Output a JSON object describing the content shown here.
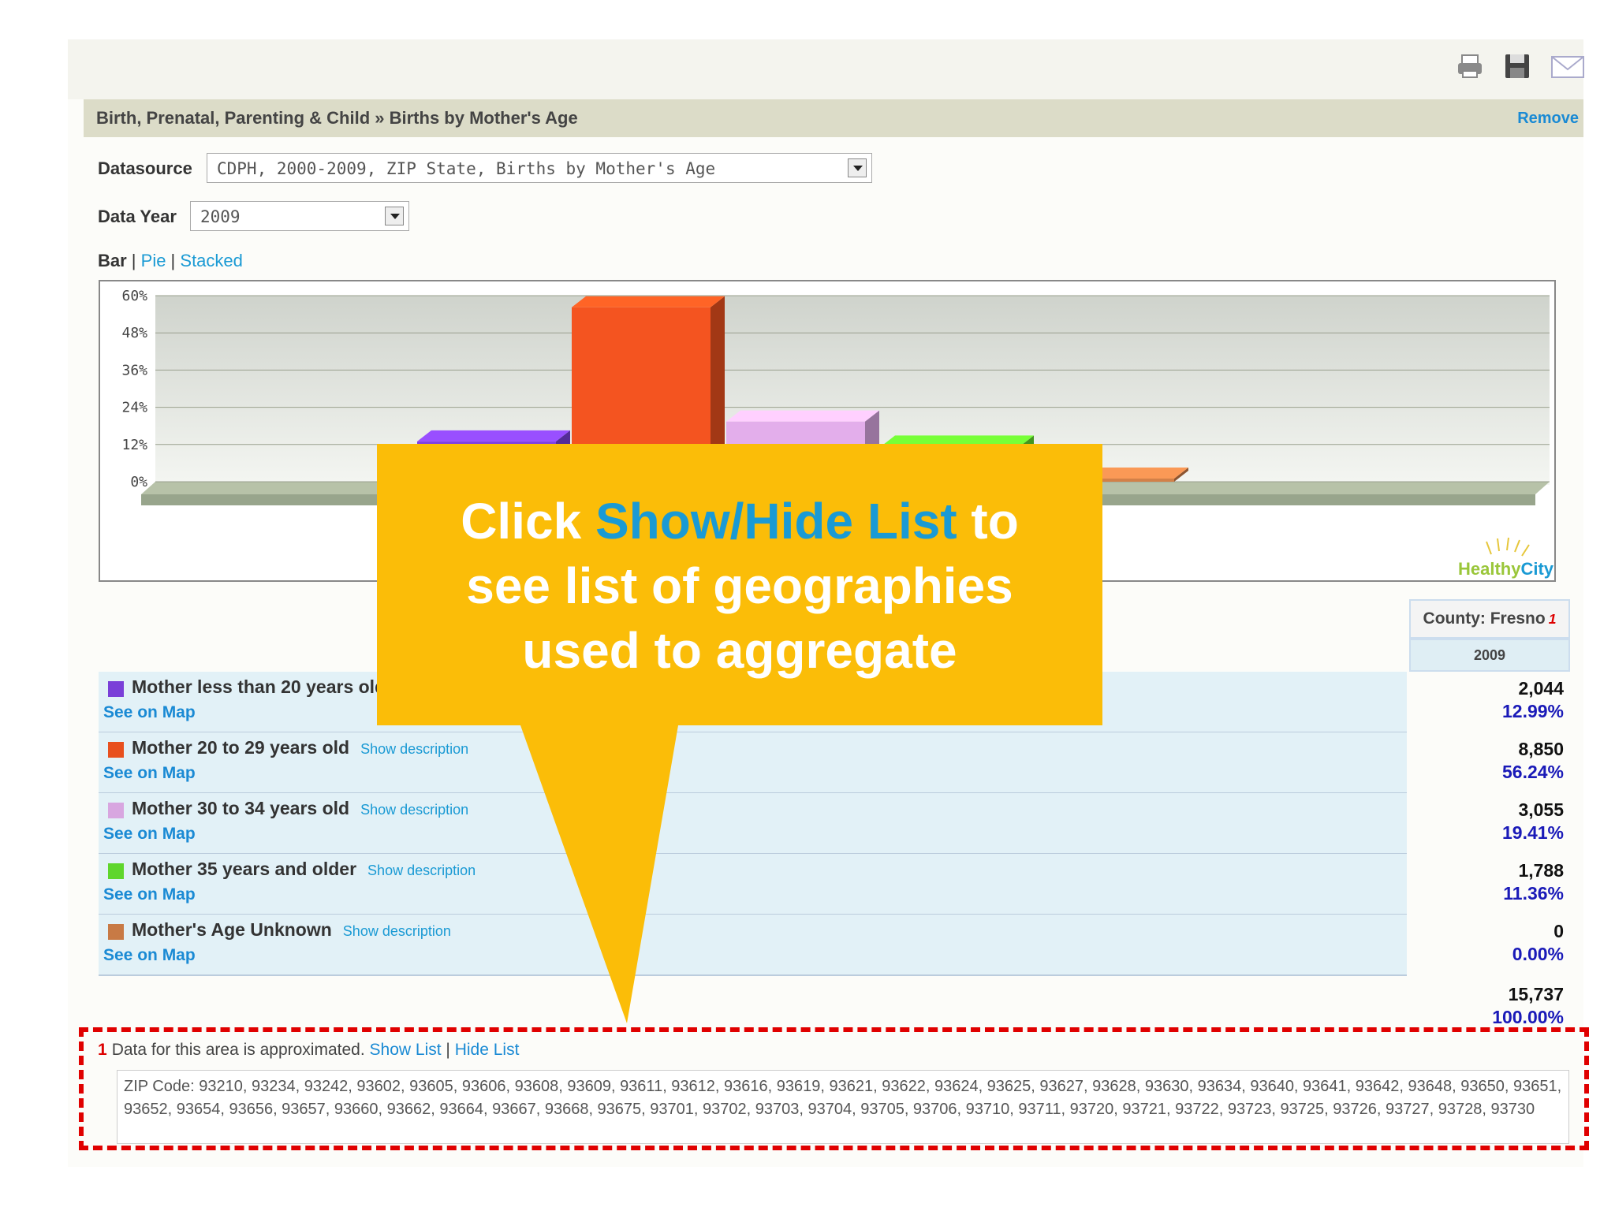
{
  "toolbar": {
    "icons": [
      "print-icon",
      "save-icon",
      "email-icon"
    ]
  },
  "breadcrumb": {
    "text": "Birth, Prenatal, Parenting & Child » Births by Mother's Age",
    "remove_label": "Remove"
  },
  "controls": {
    "datasource_label": "Datasource",
    "datasource_value": "CDPH, 2000-2009, ZIP State, Births by Mother's Age",
    "year_label": "Data Year",
    "year_value": "2009"
  },
  "chart_types": {
    "bar": "Bar",
    "sep1": " | ",
    "pie": "Pie",
    "sep2": " | ",
    "stacked": "Stacked"
  },
  "chart_data": {
    "type": "bar",
    "categories": [
      "Mother less than 20 years old",
      "Mother 20 to 29 years old",
      "Mother 30 to 34 years old",
      "Mother 35 years and older",
      "Mother's Age Unknown"
    ],
    "values": [
      12.99,
      56.24,
      19.41,
      11.36,
      0.0
    ],
    "colors": [
      "#7a3fd8",
      "#e8501e",
      "#d8a6e0",
      "#5fd62c",
      "#c87a45"
    ],
    "yticks": [
      "60%",
      "48%",
      "36%",
      "24%",
      "12%",
      "0%"
    ],
    "ylim": [
      0,
      60
    ],
    "logo": "HealthyCity"
  },
  "table": {
    "county_header": "County: Fresno",
    "county_footnote": "1",
    "year_header": "2009",
    "rows": [
      {
        "label": "Mother less than 20 years old",
        "desc": "",
        "map": "See on Map",
        "count": "2,044",
        "pct": "12.99%",
        "color": "#7a3fd8"
      },
      {
        "label": "Mother 20 to 29 years old",
        "desc": "Show description",
        "map": "See on Map",
        "count": "8,850",
        "pct": "56.24%",
        "color": "#e8501e"
      },
      {
        "label": "Mother 30 to 34 years old",
        "desc": "Show description",
        "map": "See on Map",
        "count": "3,055",
        "pct": "19.41%",
        "color": "#d8a6e0"
      },
      {
        "label": "Mother 35 years and older",
        "desc": "Show description",
        "map": "See on Map",
        "count": "1,788",
        "pct": "11.36%",
        "color": "#5fd62c"
      },
      {
        "label": "Mother's Age Unknown",
        "desc": "Show description",
        "map": "See on Map",
        "count": "0",
        "pct": "0.00%",
        "color": "#c87a45"
      }
    ],
    "total_count": "15,737",
    "total_pct": "100.00%"
  },
  "footnote": {
    "num": "1",
    "text": "Data for this area is approximated.",
    "show_list": "Show List",
    "sep": " | ",
    "hide_list": "Hide List"
  },
  "zip_list": "ZIP Code: 93210, 93234, 93242, 93602, 93605, 93606, 93608, 93609, 93611, 93612, 93616, 93619, 93621, 93622, 93624, 93625, 93627, 93628, 93630, 93634, 93640, 93641, 93642, 93648, 93650, 93651, 93652, 93654, 93656, 93657, 93660, 93662, 93664, 93667, 93668, 93675, 93701, 93702, 93703, 93704, 93705, 93706, 93710, 93711, 93720, 93721, 93722, 93723, 93725, 93726, 93727, 93728, 93730",
  "callout": {
    "line1_pre": "Click ",
    "line1_hl": "Show/Hide List",
    "line1_post": " to",
    "line2": "see list of geographies",
    "line3": "used to aggregate",
    "color": "#fbbd08"
  }
}
